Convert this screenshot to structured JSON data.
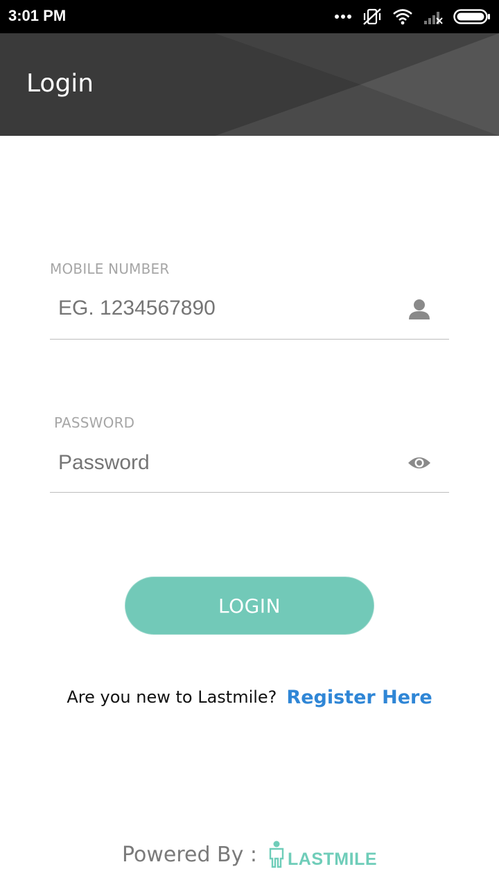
{
  "status_bar": {
    "time": "3:01 PM",
    "icons": [
      "more-dots-icon",
      "vibrate-off-icon",
      "wifi-icon",
      "signal-off-icon",
      "battery-icon"
    ]
  },
  "app_bar": {
    "title": "Login"
  },
  "mobile": {
    "label": "MOBILE NUMBER",
    "placeholder": "EG. 1234567890",
    "icon": "person-icon"
  },
  "password": {
    "label": "PASSWORD",
    "placeholder": "Password",
    "icon": "eye-icon"
  },
  "login_button": {
    "label": "LOGIN"
  },
  "register": {
    "question": "Are you new to Lastmile?",
    "link": "Register Here"
  },
  "footer": {
    "powered_by": "Powered By :",
    "brand_name": "LASTMILE"
  },
  "colors": {
    "accent": "#72c9b8",
    "link": "#2f86d6",
    "app_bar": "#3d3d3d",
    "brand": "#6fcdb9"
  }
}
